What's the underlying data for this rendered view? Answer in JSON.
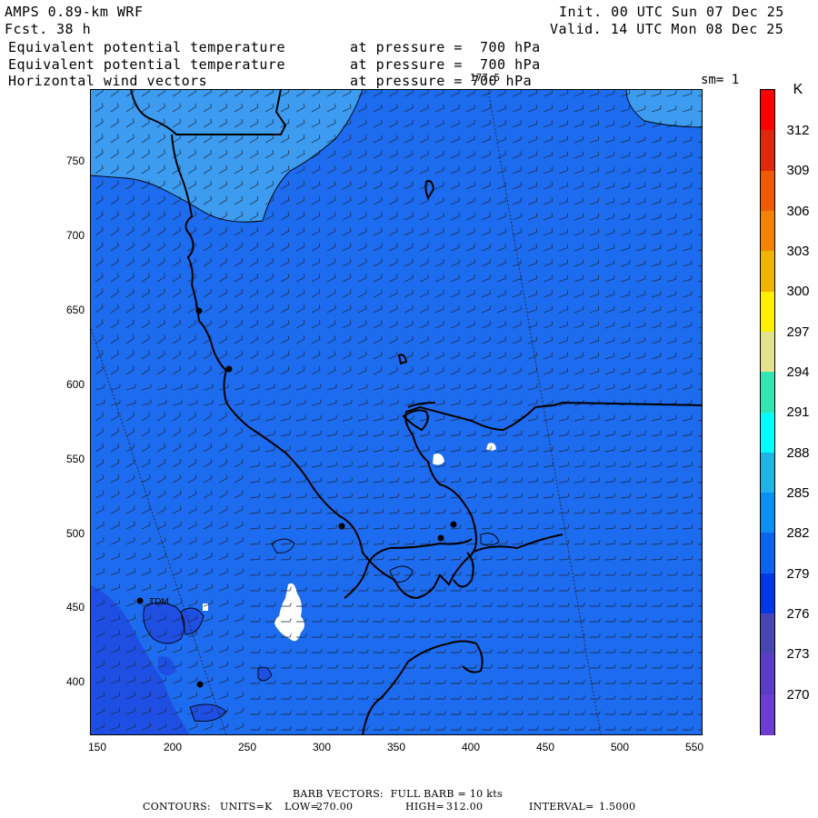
{
  "header": {
    "model": "AMPS 0.89-km WRF",
    "fcst_label": "Fcst.",
    "fcst_value": "38 h",
    "init": "Init. 00 UTC Sun 07 Dec 25",
    "valid": "Valid. 14 UTC Mon 08 Dec 25",
    "field1_name": "Equivalent potential temperature",
    "field1_level": "at pressure =  700 hPa",
    "field2_name": "Equivalent potential temperature",
    "field2_level": "at pressure =  700 hPa",
    "field3_name": "Horizontal wind vectors",
    "field3_level": "at pressure = 700 hPa",
    "longitude_label": "177.5",
    "smoothing": "sm= 1"
  },
  "axes": {
    "y_ticks": [
      "750",
      "700",
      "650",
      "600",
      "550",
      "500",
      "450",
      "400"
    ],
    "x_ticks": [
      "150",
      "200",
      "250",
      "300",
      "350",
      "400",
      "450",
      "500",
      "550"
    ],
    "x_range": [
      148,
      555
    ],
    "y_range": [
      366,
      796
    ]
  },
  "colorbar": {
    "unit": "K",
    "labels": [
      "312",
      "309",
      "306",
      "303",
      "300",
      "297",
      "294",
      "291",
      "288",
      "285",
      "282",
      "279",
      "276",
      "273",
      "270"
    ],
    "colors": [
      "#ff0000",
      "#e0280a",
      "#f05a00",
      "#f58200",
      "#f0b400",
      "#fff000",
      "#e6e28c",
      "#32e6b4",
      "#00ffff",
      "#1eb4e6",
      "#0a8ff5",
      "#0a64f0",
      "#0037e6",
      "#4646b4",
      "#5a3cc8",
      "#6e3cd2"
    ]
  },
  "map": {
    "station_label": "TDM",
    "fill_main": "#1d6bee",
    "fill_light": "#3d9bf0",
    "fill_dark": "#1e4fe2",
    "fill_white": "#ffffff"
  },
  "footer": {
    "barb_text": "BARB VECTORS:  FULL BARB = 10 kts",
    "contour_label": "CONTOURS:",
    "units": "UNITS=K",
    "low_label": "LOW=",
    "low_value": "270.00",
    "high_label": "HIGH=",
    "high_value": "312.00",
    "interval_label": "INTERVAL=",
    "interval_value": "1.5000"
  }
}
